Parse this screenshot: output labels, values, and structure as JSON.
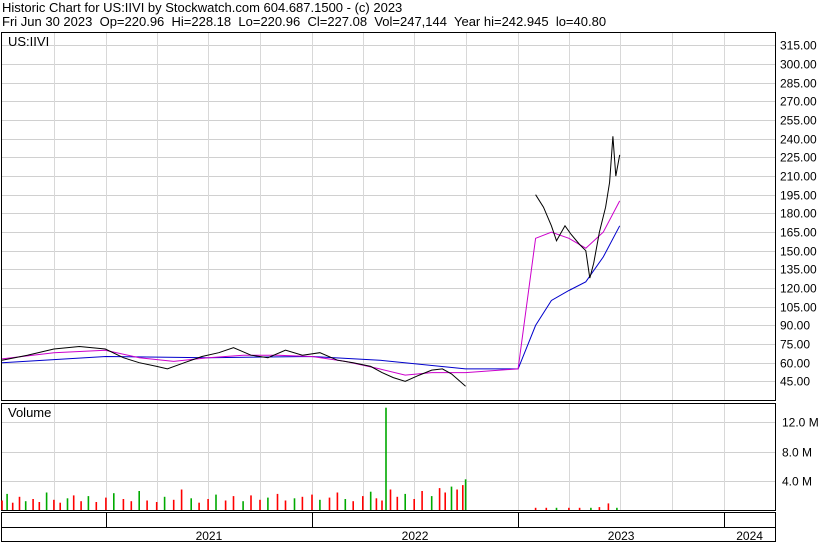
{
  "header": {
    "title": "Historic Chart for US:IIVI by Stockwatch.com 604.687.1500 - (c) 2023",
    "date": "Fri Jun 30 2023",
    "open": "Op=220.96",
    "high": "Hi=228.18",
    "low": "Lo=220.96",
    "close": "Cl=227.08",
    "volume": "Vol=247,144",
    "year_high": "Year hi=242.945",
    "year_low": "lo=40.80"
  },
  "chart_data": [
    {
      "type": "line",
      "title": "",
      "symbol_label": "US:IIVI",
      "y_ticks": [
        45,
        60,
        75,
        90,
        105,
        120,
        135,
        150,
        165,
        180,
        195,
        210,
        225,
        240,
        255,
        270,
        285,
        300,
        315
      ],
      "y_tick_labels": [
        "45.00",
        "60.00",
        "75.00",
        "90.00",
        "105.00",
        "120.00",
        "135.00",
        "150.00",
        "165.00",
        "180.00",
        "195.00",
        "210.00",
        "225.00",
        "240.00",
        "255.00",
        "270.00",
        "285.00",
        "300.00",
        "315.00"
      ],
      "ylim": [
        30,
        325
      ],
      "x_labels": [
        "2021",
        "2022",
        "2023",
        "2024"
      ],
      "x_boundaries": [
        "2021-01-01",
        "2022-01-01",
        "2023-01-01",
        "2024-01-01"
      ],
      "xlim": [
        "2020-07-01",
        "2024-03-31"
      ],
      "colors": {
        "price": "#000000",
        "ma_short": "#cc00cc",
        "ma_long": "#0000cc"
      },
      "price": [
        [
          "2020-07-01",
          62
        ],
        [
          "2020-08-15",
          66
        ],
        [
          "2020-10-01",
          71
        ],
        [
          "2020-11-15",
          73
        ],
        [
          "2020-12-31",
          71
        ],
        [
          "2021-02-01",
          64
        ],
        [
          "2021-03-01",
          60
        ],
        [
          "2021-04-01",
          57
        ],
        [
          "2021-04-20",
          55
        ],
        [
          "2021-05-20",
          60
        ],
        [
          "2021-06-20",
          65
        ],
        [
          "2021-07-20",
          68
        ],
        [
          "2021-08-15",
          72
        ],
        [
          "2021-09-15",
          66
        ],
        [
          "2021-10-15",
          64
        ],
        [
          "2021-11-15",
          70
        ],
        [
          "2021-12-15",
          66
        ],
        [
          "2022-01-15",
          68
        ],
        [
          "2022-02-15",
          62
        ],
        [
          "2022-03-15",
          60
        ],
        [
          "2022-04-15",
          57
        ],
        [
          "2022-05-05",
          52
        ],
        [
          "2022-05-25",
          48
        ],
        [
          "2022-06-15",
          45
        ],
        [
          "2022-07-10",
          50
        ],
        [
          "2022-08-01",
          54
        ],
        [
          "2022-08-20",
          55
        ],
        [
          "2022-09-05",
          51
        ],
        [
          "2022-09-20",
          45
        ],
        [
          "2022-09-30",
          41
        ]
      ],
      "price_2023": [
        [
          "2023-02-01",
          195
        ],
        [
          "2023-02-15",
          185
        ],
        [
          "2023-03-01",
          170
        ],
        [
          "2023-03-10",
          158
        ],
        [
          "2023-03-25",
          170
        ],
        [
          "2023-04-05",
          163
        ],
        [
          "2023-04-20",
          155
        ],
        [
          "2023-05-01",
          150
        ],
        [
          "2023-05-08",
          128
        ],
        [
          "2023-05-15",
          140
        ],
        [
          "2023-05-25",
          165
        ],
        [
          "2023-06-05",
          185
        ],
        [
          "2023-06-12",
          205
        ],
        [
          "2023-06-18",
          242
        ],
        [
          "2023-06-23",
          210
        ],
        [
          "2023-06-30",
          227
        ]
      ],
      "ma_short": [
        [
          "2020-07-01",
          63
        ],
        [
          "2020-10-01",
          68
        ],
        [
          "2020-12-31",
          70
        ],
        [
          "2021-03-01",
          64
        ],
        [
          "2021-05-01",
          61
        ],
        [
          "2021-07-01",
          64
        ],
        [
          "2021-09-01",
          66
        ],
        [
          "2021-11-01",
          66
        ],
        [
          "2022-01-01",
          65
        ],
        [
          "2022-03-01",
          61
        ],
        [
          "2022-05-01",
          55
        ],
        [
          "2022-06-15",
          50
        ],
        [
          "2022-08-01",
          52
        ],
        [
          "2022-09-30",
          52
        ],
        [
          "2023-01-01",
          55
        ],
        [
          "2023-02-01",
          160
        ],
        [
          "2023-03-01",
          165
        ],
        [
          "2023-04-01",
          160
        ],
        [
          "2023-05-01",
          152
        ],
        [
          "2023-06-01",
          165
        ],
        [
          "2023-06-30",
          190
        ]
      ],
      "ma_long": [
        [
          "2020-07-01",
          60
        ],
        [
          "2021-01-01",
          65
        ],
        [
          "2021-07-01",
          64
        ],
        [
          "2022-01-01",
          65
        ],
        [
          "2022-05-01",
          62
        ],
        [
          "2022-09-30",
          55
        ],
        [
          "2023-01-01",
          55
        ],
        [
          "2023-02-01",
          90
        ],
        [
          "2023-03-01",
          110
        ],
        [
          "2023-04-01",
          118
        ],
        [
          "2023-05-01",
          125
        ],
        [
          "2023-06-01",
          145
        ],
        [
          "2023-06-30",
          170
        ]
      ]
    },
    {
      "type": "bar",
      "title": "Volume",
      "y_ticks": [
        4000000,
        8000000,
        12000000
      ],
      "y_tick_labels": [
        "4.0 M",
        "8.0 M",
        "12.0 M"
      ],
      "ylim": [
        0,
        14500000
      ],
      "colors": {
        "up": "#00aa00",
        "down": "#ff0000"
      },
      "volume_bars": [
        [
          "2020-07-01",
          1.3
        ],
        [
          "2020-07-10",
          2.2
        ],
        [
          "2020-07-20",
          1.0
        ],
        [
          "2020-08-01",
          1.8
        ],
        [
          "2020-08-12",
          1.2
        ],
        [
          "2020-08-25",
          1.5
        ],
        [
          "2020-09-05",
          1.1
        ],
        [
          "2020-09-18",
          2.4
        ],
        [
          "2020-10-01",
          1.4
        ],
        [
          "2020-10-12",
          1.0
        ],
        [
          "2020-10-25",
          1.6
        ],
        [
          "2020-11-05",
          2.0
        ],
        [
          "2020-11-18",
          1.2
        ],
        [
          "2020-12-01",
          1.9
        ],
        [
          "2020-12-15",
          1.1
        ],
        [
          "2021-01-01",
          1.7
        ],
        [
          "2021-01-15",
          2.3
        ],
        [
          "2021-02-01",
          1.5
        ],
        [
          "2021-02-15",
          1.2
        ],
        [
          "2021-03-01",
          2.6
        ],
        [
          "2021-03-15",
          1.3
        ],
        [
          "2021-04-01",
          1.1
        ],
        [
          "2021-04-15",
          1.8
        ],
        [
          "2021-05-01",
          1.4
        ],
        [
          "2021-05-15",
          2.8
        ],
        [
          "2021-06-01",
          1.6
        ],
        [
          "2021-06-15",
          1.0
        ],
        [
          "2021-07-01",
          1.5
        ],
        [
          "2021-07-15",
          2.1
        ],
        [
          "2021-08-01",
          1.3
        ],
        [
          "2021-08-15",
          1.9
        ],
        [
          "2021-09-01",
          1.2
        ],
        [
          "2021-09-15",
          2.0
        ],
        [
          "2021-10-01",
          1.4
        ],
        [
          "2021-10-15",
          1.7
        ],
        [
          "2021-11-01",
          2.2
        ],
        [
          "2021-11-15",
          1.3
        ],
        [
          "2021-12-01",
          1.6
        ],
        [
          "2021-12-15",
          1.8
        ],
        [
          "2022-01-01",
          2.1
        ],
        [
          "2022-01-15",
          1.4
        ],
        [
          "2022-02-01",
          1.7
        ],
        [
          "2022-02-15",
          2.4
        ],
        [
          "2022-03-01",
          1.5
        ],
        [
          "2022-03-15",
          1.2
        ],
        [
          "2022-04-01",
          1.9
        ],
        [
          "2022-04-15",
          2.5
        ],
        [
          "2022-04-25",
          1.6
        ],
        [
          "2022-05-05",
          1.3
        ],
        [
          "2022-05-12",
          14.0
        ],
        [
          "2022-05-20",
          2.8
        ],
        [
          "2022-06-01",
          1.8
        ],
        [
          "2022-06-15",
          2.2
        ],
        [
          "2022-07-01",
          1.5
        ],
        [
          "2022-07-15",
          2.6
        ],
        [
          "2022-08-01",
          1.9
        ],
        [
          "2022-08-15",
          3.0
        ],
        [
          "2022-08-25",
          2.4
        ],
        [
          "2022-09-05",
          3.2
        ],
        [
          "2022-09-15",
          2.8
        ],
        [
          "2022-09-25",
          3.4
        ],
        [
          "2022-09-30",
          4.2
        ],
        [
          "2023-02-01",
          0.3
        ],
        [
          "2023-02-20",
          0.3
        ],
        [
          "2023-03-10",
          0.3
        ],
        [
          "2023-04-01",
          0.3
        ],
        [
          "2023-04-20",
          0.3
        ],
        [
          "2023-05-10",
          0.3
        ],
        [
          "2023-05-25",
          0.4
        ],
        [
          "2023-06-10",
          0.9
        ],
        [
          "2023-06-25",
          0.3
        ]
      ]
    }
  ]
}
